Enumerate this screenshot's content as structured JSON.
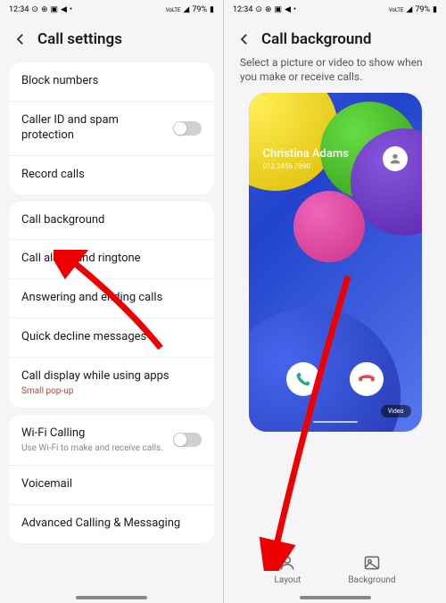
{
  "status": {
    "time": "12:34",
    "battery": "79%",
    "lte": "VoLTE"
  },
  "left": {
    "title": "Call settings",
    "group1": [
      {
        "label": "Block numbers"
      },
      {
        "label": "Caller ID and spam protection",
        "toggle": true
      },
      {
        "label": "Record calls"
      }
    ],
    "group2": [
      {
        "label": "Call background"
      },
      {
        "label": "Call alerts and ringtone"
      },
      {
        "label": "Answering and ending calls"
      },
      {
        "label": "Quick decline messages"
      },
      {
        "label": "Call display while using apps",
        "sub": "Small pop-up"
      }
    ],
    "group3": [
      {
        "label": "Wi-Fi Calling",
        "sub": "Use Wi-Fi to make and receive calls.",
        "toggle": true
      },
      {
        "label": "Voicemail"
      },
      {
        "label": "Advanced Calling & Messaging"
      }
    ]
  },
  "right": {
    "title": "Call background",
    "subtitle": "Select a picture or video to show when you make or receive calls.",
    "caller_name": "Christina Adams",
    "caller_number": "012 3456 7890",
    "video_label": "Video",
    "tabs": {
      "layout": "Layout",
      "background": "Background"
    }
  }
}
